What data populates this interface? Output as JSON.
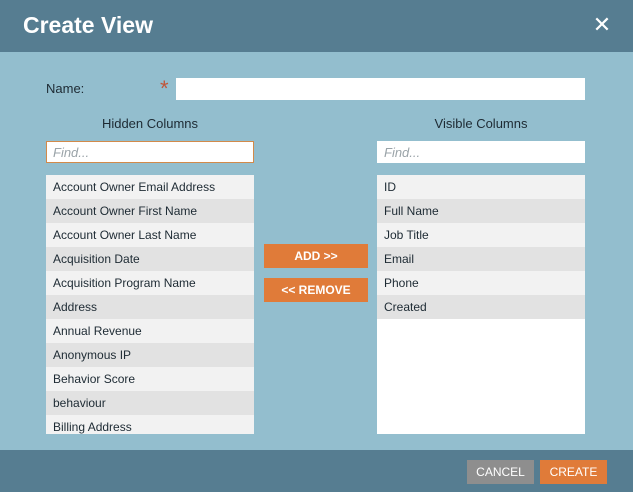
{
  "dialog": {
    "title": "Create View",
    "close_icon": "close-icon"
  },
  "form": {
    "name_label": "Name:",
    "required_marker": "*",
    "name_value": ""
  },
  "hidden_columns": {
    "header": "Hidden Columns",
    "find_placeholder": "Find...",
    "items": [
      "Account Owner Email Address",
      "Account Owner First Name",
      "Account Owner Last Name",
      "Acquisition Date",
      "Acquisition Program Name",
      "Address",
      "Annual Revenue",
      "Anonymous IP",
      "Behavior Score",
      "behaviour",
      "Billing Address"
    ]
  },
  "visible_columns": {
    "header": "Visible Columns",
    "find_placeholder": "Find...",
    "items": [
      "ID",
      "Full Name",
      "Job Title",
      "Email",
      "Phone",
      "Created"
    ]
  },
  "actions": {
    "add_label": "ADD >>",
    "remove_label": "<< REMOVE"
  },
  "footer": {
    "cancel_label": "CANCEL",
    "create_label": "CREATE"
  },
  "colors": {
    "titlebar": "#567d91",
    "body": "#93bece",
    "accent": "#e07b39",
    "cancel": "#8e8e8e"
  }
}
